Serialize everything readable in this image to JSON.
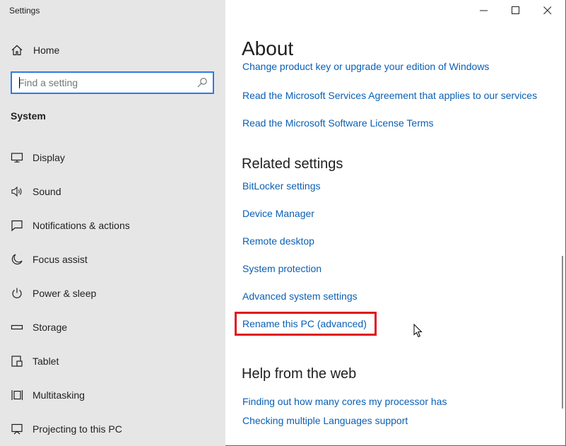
{
  "window": {
    "title": "Settings"
  },
  "sidebar": {
    "home_label": "Home",
    "search_placeholder": "Find a setting",
    "section_title": "System",
    "items": [
      {
        "label": "Display",
        "icon": "display-icon"
      },
      {
        "label": "Sound",
        "icon": "sound-icon"
      },
      {
        "label": "Notifications & actions",
        "icon": "notifications-icon"
      },
      {
        "label": "Focus assist",
        "icon": "moon-icon"
      },
      {
        "label": "Power & sleep",
        "icon": "power-icon"
      },
      {
        "label": "Storage",
        "icon": "storage-icon"
      },
      {
        "label": "Tablet",
        "icon": "tablet-icon"
      },
      {
        "label": "Multitasking",
        "icon": "multitasking-icon"
      },
      {
        "label": "Projecting to this PC",
        "icon": "projecting-icon"
      }
    ]
  },
  "main": {
    "title": "About",
    "links_top": [
      "Change product key or upgrade your edition of Windows",
      "Read the Microsoft Services Agreement that applies to our services",
      "Read the Microsoft Software License Terms"
    ],
    "related_heading": "Related settings",
    "related_links": [
      "BitLocker settings",
      "Device Manager",
      "Remote desktop",
      "System protection",
      "Advanced system settings",
      "Rename this PC (advanced)"
    ],
    "help_heading": "Help from the web",
    "help_links": [
      "Finding out how many cores my processor has",
      "Checking multiple Languages support"
    ]
  },
  "colors": {
    "link": "#0a5fb4",
    "highlight": "#e0141d",
    "sidebar_bg": "#e6e6e6",
    "accent": "#2c7be5"
  }
}
